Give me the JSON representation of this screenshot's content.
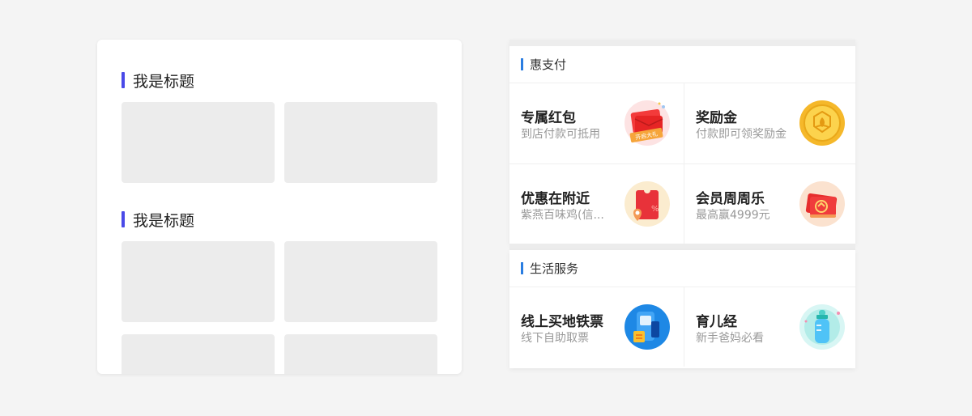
{
  "left": {
    "sections": [
      {
        "title": "我是标题"
      },
      {
        "title": "我是标题"
      }
    ]
  },
  "right": {
    "section1": {
      "title": "惠支付",
      "items": [
        {
          "title": "专属红包",
          "subtitle": "到店付款可抵用",
          "icon": "red-envelope-icon",
          "badge": "开启大礼"
        },
        {
          "title": "奖励金",
          "subtitle": "付款即可领奖励金",
          "icon": "gold-coin-icon"
        },
        {
          "title": "优惠在附近",
          "subtitle": "紫燕百味鸡(信...",
          "icon": "coupon-location-icon"
        },
        {
          "title": "会员周周乐",
          "subtitle": "最高赢4999元",
          "icon": "member-gift-icon"
        }
      ]
    },
    "section2": {
      "title": "生活服务",
      "items": [
        {
          "title": "线上买地铁票",
          "subtitle": "线下自助取票",
          "icon": "subway-ticket-icon"
        },
        {
          "title": "育儿经",
          "subtitle": "新手爸妈必看",
          "icon": "baby-bottle-icon"
        }
      ]
    }
  },
  "colors": {
    "left_accent": "#4a4ae8",
    "right_accent": "#2a7de1",
    "placeholder": "#ececec"
  }
}
